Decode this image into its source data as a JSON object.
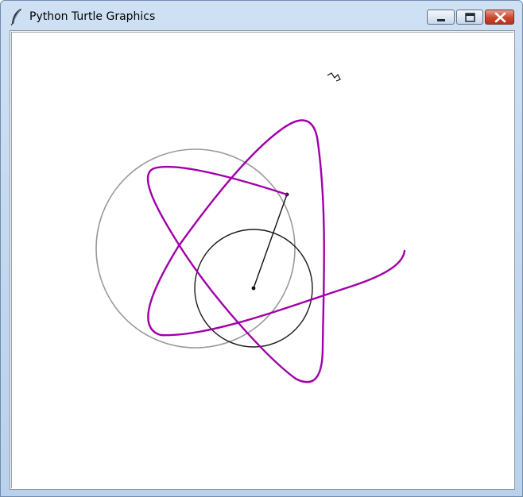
{
  "window": {
    "title": "Python Turtle Graphics",
    "icon": "feather-icon",
    "controls": [
      "minimize-icon",
      "maximize-icon",
      "close-icon"
    ]
  },
  "canvas": {
    "background": "#ffffff",
    "colors": {
      "curve": "#a000a8",
      "outer_circle": "#999999",
      "inner_circle": "#1a1a1a",
      "arm": "#111111"
    }
  }
}
